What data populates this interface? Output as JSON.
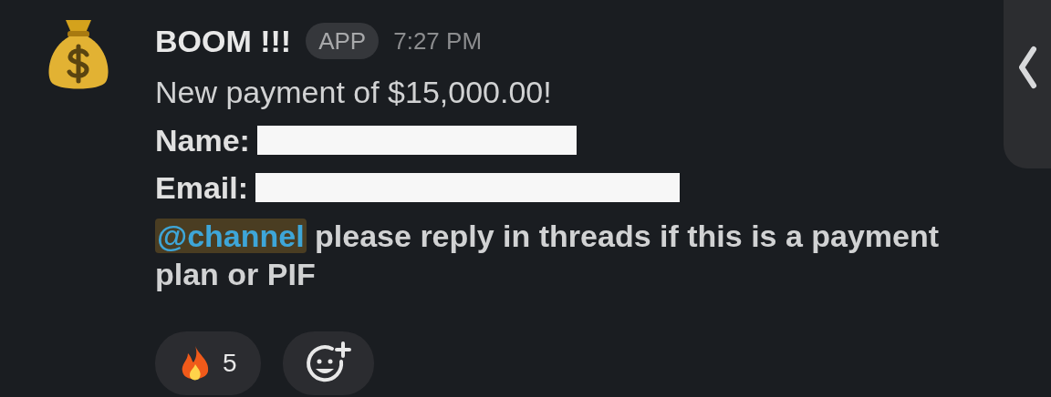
{
  "message": {
    "sender": "BOOM !!!",
    "badge": "APP",
    "time": "7:27 PM",
    "headline": "New payment of $15,000.00!",
    "fields": [
      {
        "label": "Name:",
        "redacted": true
      },
      {
        "label": "Email:",
        "redacted": true
      }
    ],
    "mention": "@channel",
    "text": "please reply in threads if this is a payment plan or PIF"
  },
  "reactions": [
    {
      "count": "5"
    }
  ]
}
